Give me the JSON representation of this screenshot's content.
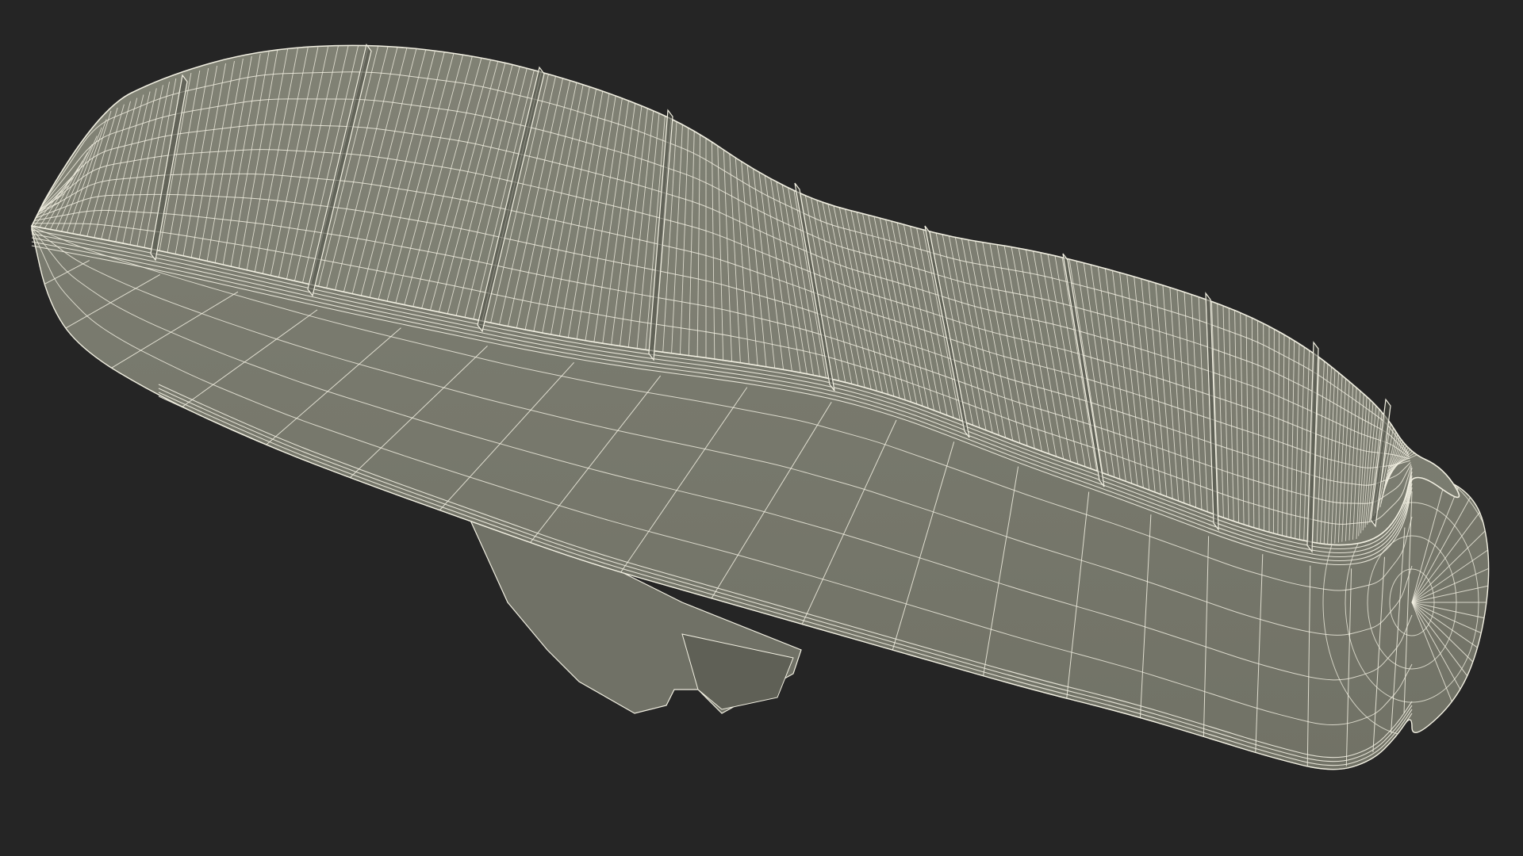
{
  "scene": {
    "subject": "shoe-sole-wireframe",
    "render_mode": "wireframe-on-shaded"
  },
  "colors": {
    "background": "#252525",
    "surface": "#7d7e72",
    "surface_dark": "#6d6e62",
    "surface_light": "#8a8b7e",
    "wire": "#f2f0e2",
    "shadow": "#4b4c44"
  }
}
